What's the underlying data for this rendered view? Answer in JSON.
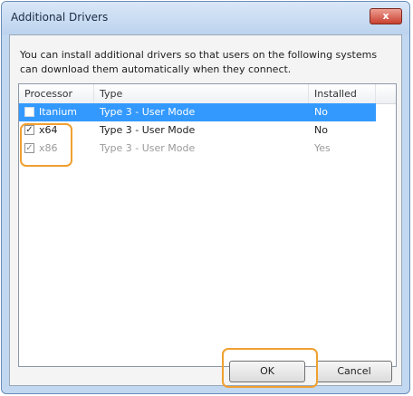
{
  "window": {
    "title": "Additional Drivers",
    "close_glyph": "x"
  },
  "description": "You can install additional drivers so that users on the following systems can download them automatically when they connect.",
  "table": {
    "headers": [
      "Processor",
      "Type",
      "Installed"
    ],
    "rows": [
      {
        "processor": "Itanium",
        "type": "Type 3 - User Mode",
        "installed": "No",
        "checked": false,
        "selected": true
      },
      {
        "processor": "x64",
        "type": "Type 3 - User Mode",
        "installed": "No",
        "checked": true,
        "selected": false
      },
      {
        "processor": "x86",
        "type": "Type 3 - User Mode",
        "installed": "Yes",
        "checked": true,
        "selected": false
      }
    ]
  },
  "buttons": {
    "ok_label": "OK",
    "cancel_label": "Cancel"
  },
  "colors": {
    "selection": "#3399ff",
    "highlight_outline": "#f0a030",
    "close_button": "#c9402f"
  },
  "icons": {
    "close": "close-icon",
    "checkbox_checked": "checkmark-icon"
  }
}
